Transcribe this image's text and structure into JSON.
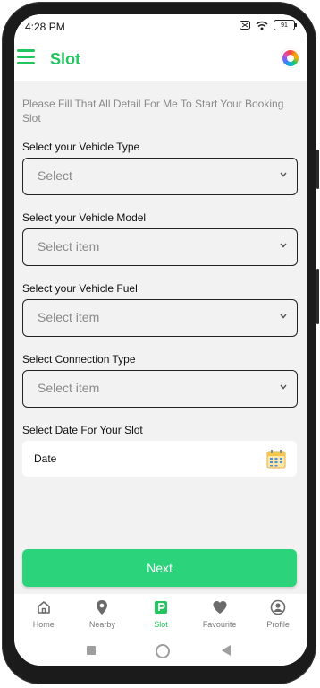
{
  "status_bar": {
    "time": "4:28 PM",
    "battery": "91"
  },
  "app_bar": {
    "title": "Slot"
  },
  "form": {
    "intro": "Please Fill That All Detail For Me To Start Your Booking Slot",
    "fields": [
      {
        "label": "Select your Vehicle Type",
        "value": "Select"
      },
      {
        "label": "Select your Vehicle Model",
        "value": "Select item"
      },
      {
        "label": "Select your Vehicle Fuel",
        "value": "Select item"
      },
      {
        "label": "Select Connection Type",
        "value": "Select item"
      }
    ],
    "date_label": "Select Date For Your Slot",
    "date_value": "Date",
    "next_label": "Next"
  },
  "bottom_nav": {
    "items": [
      {
        "label": "Home",
        "icon": "home-icon"
      },
      {
        "label": "Nearby",
        "icon": "location-pin-icon"
      },
      {
        "label": "Slot",
        "icon": "parking-icon",
        "active": true
      },
      {
        "label": "Favourite",
        "icon": "heart-icon"
      },
      {
        "label": "Profile",
        "icon": "profile-icon"
      }
    ]
  },
  "colors": {
    "accent": "#22c55e",
    "button": "#2bd47a",
    "background": "#f2f2f2"
  }
}
